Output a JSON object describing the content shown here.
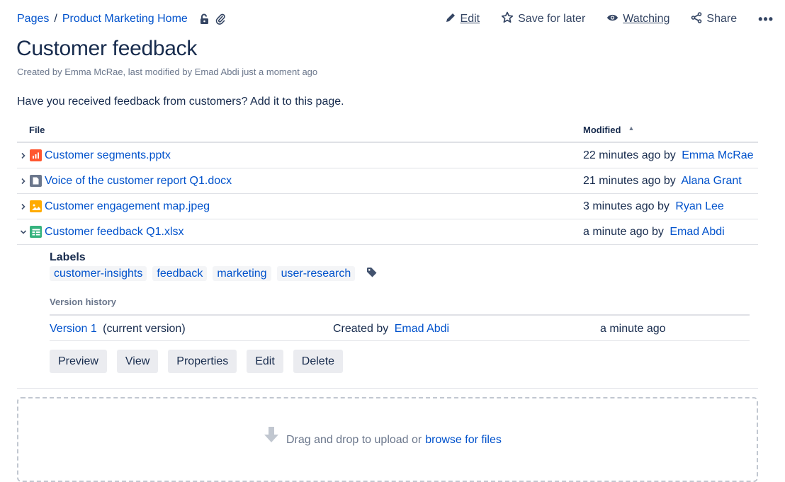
{
  "breadcrumb": {
    "root": "Pages",
    "separator": "/",
    "parent": "Product Marketing Home"
  },
  "actions": {
    "edit": "Edit",
    "save_for_later": "Save for later",
    "watching": "Watching",
    "share": "Share",
    "more": "•••"
  },
  "page": {
    "title": "Customer feedback",
    "byline": "Created by Emma McRae, last modified by Emad Abdi just a moment ago",
    "intro": "Have you received feedback from customers? Add it to this page."
  },
  "table": {
    "headers": {
      "file": "File",
      "modified": "Modified"
    },
    "rows": [
      {
        "name": "Customer segments.pptx",
        "type": "presentation",
        "color": "#ff5630",
        "time": "22 minutes ago by",
        "user": "Emma McRae"
      },
      {
        "name": "Voice of the customer report Q1.docx",
        "type": "document",
        "color": "#6b778c",
        "time": "21 minutes ago by",
        "user": "Alana Grant"
      },
      {
        "name": "Customer engagement map.jpeg",
        "type": "image",
        "color": "#ffab00",
        "time": "3 minutes ago by",
        "user": "Ryan Lee"
      },
      {
        "name": "Customer feedback Q1.xlsx",
        "type": "spreadsheet",
        "color": "#36b37e",
        "time": "a minute ago by",
        "user": "Emad Abdi"
      }
    ]
  },
  "details": {
    "labels_heading": "Labels",
    "labels": [
      "customer-insights",
      "feedback",
      "marketing",
      "user-research"
    ],
    "version_history_heading": "Version history",
    "version": {
      "version_link": "Version 1",
      "version_suffix": "(current version)",
      "created_prefix": "Created by",
      "created_user": "Emad Abdi",
      "time": "a minute ago"
    },
    "buttons": [
      "Preview",
      "View",
      "Properties",
      "Edit",
      "Delete"
    ]
  },
  "dropzone": {
    "text": "Drag and drop to upload or",
    "link": "browse for files"
  },
  "colors": {
    "link": "#0052cc",
    "text": "#172b4d",
    "muted": "#6b778c",
    "button_bg": "#ebecf0",
    "border": "#dfe1e6"
  }
}
